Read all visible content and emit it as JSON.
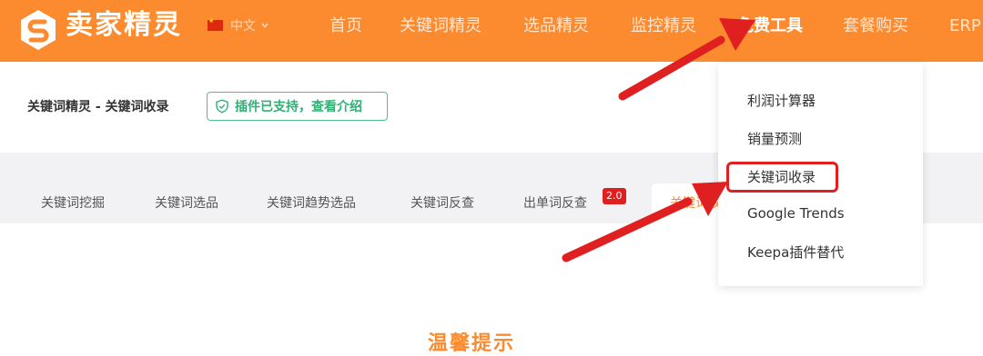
{
  "header": {
    "brand": "卖家精灵",
    "language": "中文",
    "nav": [
      "首页",
      "关键词精灵",
      "选品精灵",
      "监控精灵",
      "免费工具",
      "套餐购买",
      "ERP"
    ]
  },
  "breadcrumb": "关键词精灵 - 关键词收录",
  "plugin_badge": "插件已支持，查看介绍",
  "tabs": {
    "items": [
      "关键词挖掘",
      "关键词选品",
      "关键词趋势选品",
      "关键词反查",
      "出单词反查"
    ],
    "new_badge": "2.0",
    "active_partial": "关键词收"
  },
  "dropdown": {
    "items": [
      "利润计算器",
      "销量预测",
      "关键词收录",
      "Google Trends",
      "Keepa插件替代"
    ],
    "highlighted": "关键词收录"
  },
  "notice_title": "温馨提示",
  "colors": {
    "brand_orange": "#fc8a2e",
    "annotation_red": "#e02020",
    "plugin_green": "#2fb074"
  }
}
